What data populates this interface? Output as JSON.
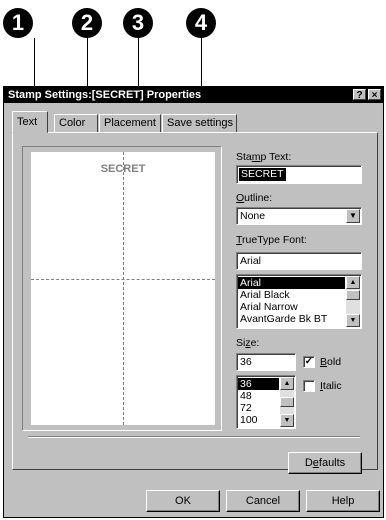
{
  "callouts": [
    "1",
    "2",
    "3",
    "4"
  ],
  "dialog": {
    "title": "Stamp Settings:[SECRET] Properties",
    "help_glyph": "?",
    "close_glyph": "×"
  },
  "tabs": [
    {
      "label": "Text",
      "active": true
    },
    {
      "label": "Color",
      "active": false
    },
    {
      "label": "Placement",
      "active": false
    },
    {
      "label": "Save settings",
      "active": false
    }
  ],
  "preview": {
    "stamp_text": "SECRET"
  },
  "stamp_text": {
    "label_pre": "Sta",
    "label_key": "m",
    "label_post": "p Text:",
    "value": "SECRET"
  },
  "outline": {
    "label_key": "O",
    "label_post": "utline:",
    "value": "None"
  },
  "truetype_font": {
    "label_key": "T",
    "label_post": "rueType Font:",
    "value": "Arial",
    "options": [
      "Arial",
      "Arial Black",
      "Arial Narrow",
      "AvantGarde Bk BT"
    ],
    "selected": "Arial"
  },
  "size": {
    "label_pre": "Si",
    "label_key": "z",
    "label_post": "e:",
    "value": "36",
    "options": [
      "36",
      "48",
      "72",
      "100"
    ],
    "selected": "36"
  },
  "bold": {
    "label_key": "B",
    "label_post": "old",
    "checked": true,
    "check_glyph": "✓"
  },
  "italic": {
    "label_key": "I",
    "label_post": "talic",
    "checked": false
  },
  "buttons": {
    "defaults": {
      "label_pre": "D",
      "label_key": "e",
      "label_post": "faults"
    },
    "ok": "OK",
    "cancel": "Cancel",
    "help": "Help"
  },
  "icons": {
    "combo_arrow": "▼",
    "scroll_up": "▲",
    "scroll_down": "▼"
  }
}
